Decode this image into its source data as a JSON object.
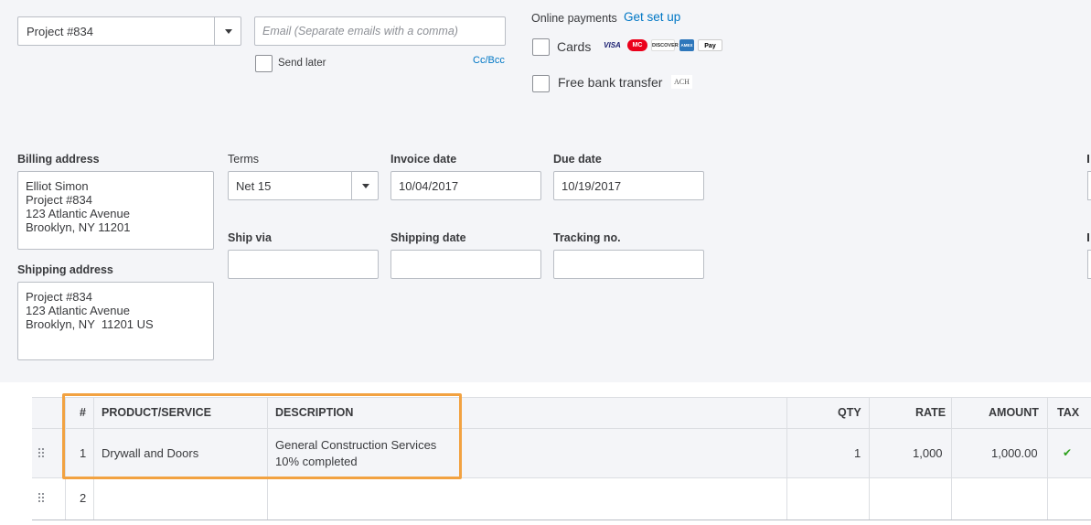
{
  "customer_select": {
    "value": "Project #834"
  },
  "email": {
    "placeholder": "Email (Separate emails with a comma)",
    "send_later_label": "Send later",
    "cc_bcc_label": "Cc/Bcc"
  },
  "online_payments": {
    "title": "Online payments",
    "setup_link": "Get set up",
    "cards_label": "Cards",
    "card_logos": [
      "VISA",
      "MC",
      "DISCOVER",
      "AMEX",
      "Pay"
    ],
    "bank_label": "Free bank transfer",
    "bank_badge": "ACH"
  },
  "billing": {
    "label": "Billing address",
    "lines": [
      "Elliot Simon",
      "Project #834",
      "123 Atlantic Avenue",
      "Brooklyn, NY 11201"
    ]
  },
  "shipping": {
    "label": "Shipping address",
    "lines": [
      "Project #834",
      "123 Atlantic Avenue",
      "Brooklyn, NY  11201 US"
    ]
  },
  "terms": {
    "label": "Terms",
    "value": "Net 15"
  },
  "invoice_date": {
    "label": "Invoice date",
    "value": "10/04/2017"
  },
  "due_date": {
    "label": "Due date",
    "value": "10/19/2017"
  },
  "ship_via": {
    "label": "Ship via",
    "value": ""
  },
  "shipping_date": {
    "label": "Shipping date",
    "value": ""
  },
  "tracking_no": {
    "label": "Tracking no.",
    "value": ""
  },
  "table": {
    "headers": {
      "num": "#",
      "product": "PRODUCT/SERVICE",
      "description": "DESCRIPTION",
      "qty": "QTY",
      "rate": "RATE",
      "amount": "AMOUNT",
      "tax": "TAX"
    },
    "rows": [
      {
        "num": "1",
        "product": "Drywall and Doors",
        "description_line1": "General Construction Services",
        "description_line2": "10% completed",
        "qty": "1",
        "rate": "1,000",
        "amount": "1,000.00",
        "tax": "✔"
      },
      {
        "num": "2",
        "product": "",
        "description_line1": "",
        "description_line2": "",
        "qty": "",
        "rate": "",
        "amount": "",
        "tax": ""
      }
    ]
  },
  "colors": {
    "link": "#0077c5",
    "highlight": "#f2a241",
    "check": "#2ca01c"
  }
}
